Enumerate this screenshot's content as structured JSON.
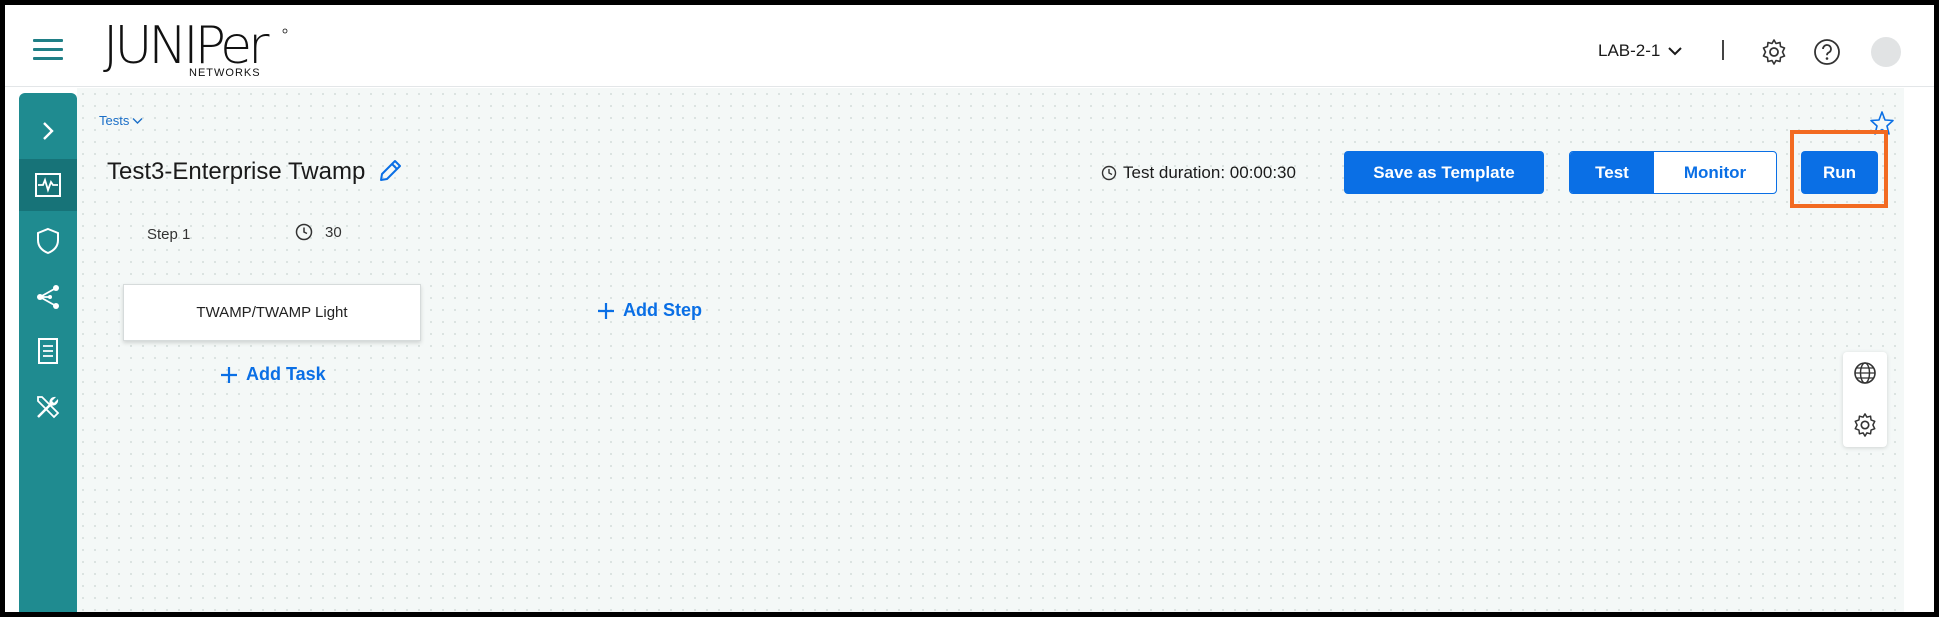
{
  "header": {
    "logo_text": "JUNIPer",
    "logo_subtext": "NETWORKS",
    "site_selector": "LAB-2-1",
    "icons": [
      "menu-icon",
      "chevron-down-icon",
      "settings-gear-icon",
      "help-icon",
      "avatar"
    ]
  },
  "sidebar": {
    "items": [
      {
        "name": "expand",
        "icon": "chevron-right-icon"
      },
      {
        "name": "monitor",
        "icon": "pulse-monitor-icon"
      },
      {
        "name": "security",
        "icon": "shield-icon"
      },
      {
        "name": "network",
        "icon": "share-network-icon"
      },
      {
        "name": "reports",
        "icon": "document-list-icon"
      },
      {
        "name": "tools",
        "icon": "tools-icon"
      }
    ]
  },
  "main": {
    "breadcrumb": "Tests",
    "title": "Test3-Enterprise Twamp",
    "duration_label": "Test duration: 00:00:30",
    "save_template_label": "Save as Template",
    "segment": {
      "test_label": "Test",
      "monitor_label": "Monitor",
      "selected": "Test"
    },
    "run_label": "Run",
    "step": {
      "label": "Step 1",
      "timer_value": "30"
    },
    "task_card_label": "TWAMP/TWAMP Light",
    "add_step_label": "Add Step",
    "add_task_label": "Add Task",
    "float_panel_icons": [
      "globe-icon",
      "settings-gear-icon"
    ]
  },
  "colors": {
    "primary": "#0a6fe5",
    "sidebar": "#1f8b90",
    "highlight": "#f26a21",
    "canvas": "#f4f8f7"
  }
}
